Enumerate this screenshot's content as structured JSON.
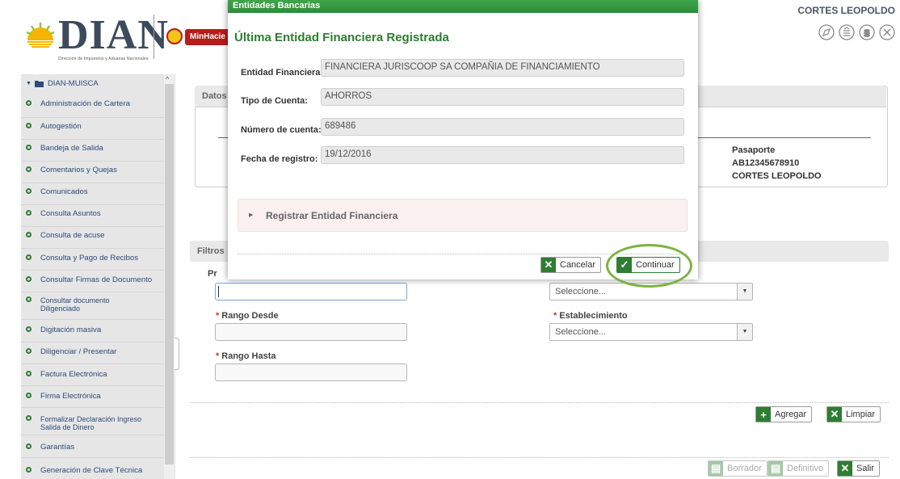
{
  "header": {
    "logo_text": "DIAN",
    "logo_reg": "®",
    "logo_subtitle": "Dirección de Impuestos y Aduanas Nacionales",
    "ministry_badge": "MinHacie",
    "user_name": "CORTES LEOPOLDO",
    "icons": [
      "compass-icon",
      "list-icon",
      "coins-icon",
      "close-circle-icon"
    ]
  },
  "sidebar": {
    "root_label": "DIAN-MUISCA",
    "items": [
      {
        "label": "Administración de Cartera"
      },
      {
        "label": "Autogestión"
      },
      {
        "label": "Bandeja de Salida"
      },
      {
        "label": "Comentarios y Quejas"
      },
      {
        "label": "Comunicados"
      },
      {
        "label": "Consulta Asuntos"
      },
      {
        "label": "Consulta de acuse"
      },
      {
        "label": "Consulta y Pago de Recibos"
      },
      {
        "label": "Consultar Firmas de Documento"
      },
      {
        "label": "Consultar documento Diligenciado"
      },
      {
        "label": "Digitación masiva"
      },
      {
        "label": "Diligenciar / Presentar"
      },
      {
        "label": "Factura Electrónica"
      },
      {
        "label": "Firma Electrónica"
      },
      {
        "label": "Formalizar Declaración Ingreso Salida de Dinero"
      },
      {
        "label": "Garantías"
      },
      {
        "label": "Generación de Clave Técnica"
      }
    ]
  },
  "datos": {
    "title": "Datos",
    "doc_type": "Pasaporte",
    "doc_number": "AB12345678910",
    "name": "CORTES LEOPOLDO"
  },
  "filtros": {
    "title": "Filtros",
    "field_pr_label": "Pr",
    "rango_desde_label": "Rango Desde",
    "rango_hasta_label": "Rango Hasta",
    "select1_value": "Seleccione...",
    "establecimiento_label": "Establecimiento",
    "select2_value": "Seleccione...",
    "required_mark": "*"
  },
  "actions": {
    "agregar": "Agregar",
    "limpiar": "Limpiar",
    "borrador": "Borrador",
    "definitivo": "Definitivo",
    "salir": "Salir"
  },
  "modal": {
    "bar_title": "Entidades Bancarias",
    "heading": "Última Entidad Financiera Registrada",
    "fields": [
      {
        "label": "Entidad Financiera:",
        "value": "FINANCIERA JURISCOOP SA COMPAÑIA DE FINANCIAMIENTO"
      },
      {
        "label": "Tipo de Cuenta:",
        "value": "AHORROS"
      },
      {
        "label": "Número de cuenta:",
        "value": "689486"
      },
      {
        "label": "Fecha de registro:",
        "value": "19/12/2016"
      }
    ],
    "accordion_label": "Registrar Entidad Financiera",
    "cancel_label": "Cancelar",
    "continue_label": "Continuar"
  },
  "colors": {
    "accent_green": "#2e7d32",
    "header_bar": "#3fa54a",
    "highlight_ring": "#7cb342",
    "link_blue": "#2b4b7a"
  }
}
